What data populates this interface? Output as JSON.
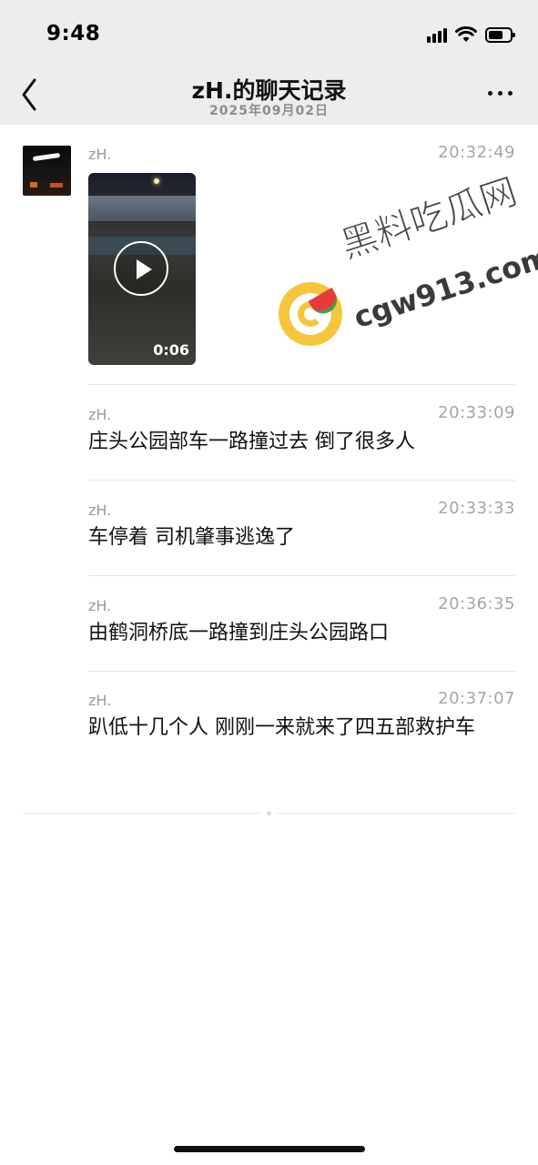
{
  "status_bar": {
    "time": "9:48",
    "icons": [
      "cellular-signal-icon",
      "wifi-icon",
      "battery-icon"
    ]
  },
  "nav": {
    "back_icon": "chevron-left-icon",
    "title": "zH.的聊天记录",
    "subtitle": "2025年09月02日",
    "more_icon": "ellipsis-icon"
  },
  "video_message": {
    "sender": "zH.",
    "time": "20:32:49",
    "duration": "0:06"
  },
  "watermark": {
    "text_cn": "黑料吃瓜网",
    "text_domain": "cgw913.com",
    "colors": {
      "circle": "#f5c63b",
      "melon": "#e63b3b",
      "rind": "#2fa84f"
    }
  },
  "messages": [
    {
      "sender": "zH.",
      "time": "20:33:09",
      "text": "庄头公园部车一路撞过去  倒了很多人"
    },
    {
      "sender": "zH.",
      "time": "20:33:33",
      "text": "车停着   司机肇事逃逸了"
    },
    {
      "sender": "zH.",
      "time": "20:36:35",
      "text": "由鹤洞桥底一路撞到庄头公园路口"
    },
    {
      "sender": "zH.",
      "time": "20:37:07",
      "text": "趴低十几个人   刚刚一来就来了四五部救护车"
    }
  ],
  "colors": {
    "header_bg": "#ededed",
    "meta_text": "#9a9a9a",
    "body_text": "#111111"
  }
}
